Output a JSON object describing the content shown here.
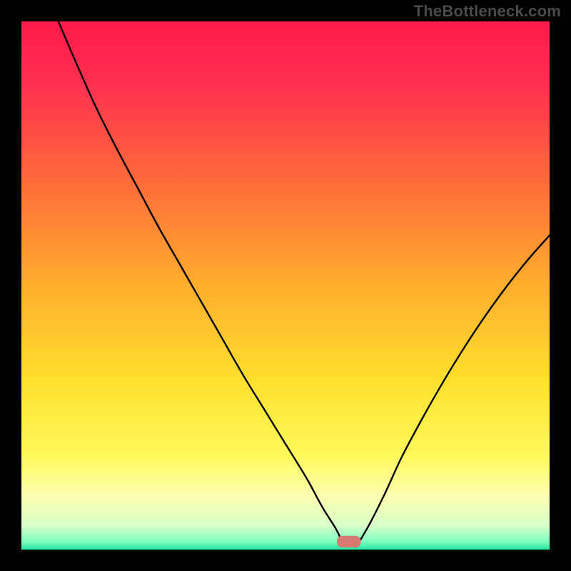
{
  "attribution": "TheBottleneck.com",
  "chart_data": {
    "type": "line",
    "title": "",
    "xlabel": "",
    "ylabel": "",
    "xlim": [
      0,
      100
    ],
    "ylim": [
      0,
      100
    ],
    "grid": false,
    "legend": false,
    "background": {
      "type": "vertical-gradient",
      "stops": [
        {
          "pos": 0.0,
          "color": "#ff1a4b"
        },
        {
          "pos": 0.12,
          "color": "#ff3050"
        },
        {
          "pos": 0.3,
          "color": "#ff6a3a"
        },
        {
          "pos": 0.5,
          "color": "#ffae2d"
        },
        {
          "pos": 0.68,
          "color": "#ffe02e"
        },
        {
          "pos": 0.82,
          "color": "#fff95a"
        },
        {
          "pos": 0.9,
          "color": "#fbffb0"
        },
        {
          "pos": 0.955,
          "color": "#d8ffc8"
        },
        {
          "pos": 0.985,
          "color": "#7effc0"
        },
        {
          "pos": 1.0,
          "color": "#22e6a0"
        }
      ]
    },
    "marker": {
      "x": 62,
      "y": 1.5,
      "width": 4.5,
      "height": 2.2,
      "color": "#d77a6f"
    },
    "series": [
      {
        "name": "left-branch",
        "x": [
          7.0,
          10,
          14,
          18,
          22,
          26,
          30,
          34,
          38,
          42,
          46,
          50,
          54,
          57,
          59.5,
          60.8
        ],
        "y": [
          100,
          93,
          84,
          76,
          68.5,
          61,
          54,
          47,
          40,
          33,
          26.5,
          20,
          13.5,
          8,
          4,
          1.3
        ]
      },
      {
        "name": "right-branch",
        "x": [
          63.8,
          66,
          69,
          72,
          76,
          80,
          84,
          88,
          92,
          96,
          100
        ],
        "y": [
          1.2,
          5,
          11,
          17.5,
          25,
          32,
          38.5,
          44.5,
          50,
          55,
          59.5
        ]
      }
    ]
  }
}
